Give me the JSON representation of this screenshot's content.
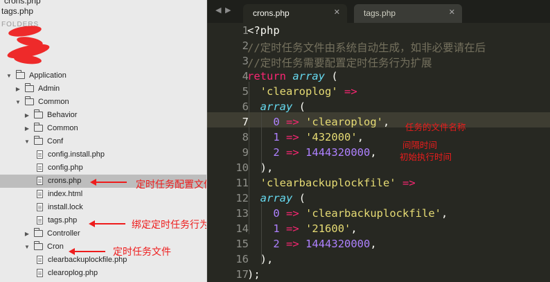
{
  "sidebar": {
    "open_files": [
      "crons.php",
      "tags.php"
    ],
    "section_header": "FOLDERS",
    "tree": [
      {
        "label": "Application",
        "type": "folder",
        "expanded": true
      },
      {
        "label": "Admin",
        "type": "folder",
        "expanded": false
      },
      {
        "label": "Common",
        "type": "folder",
        "expanded": true
      },
      {
        "label": "Behavior",
        "type": "folder",
        "expanded": false
      },
      {
        "label": "Common",
        "type": "folder",
        "expanded": false
      },
      {
        "label": "Conf",
        "type": "folder",
        "expanded": true
      },
      {
        "label": "config.install.php",
        "type": "file"
      },
      {
        "label": "config.php",
        "type": "file"
      },
      {
        "label": "crons.php",
        "type": "file",
        "selected": true
      },
      {
        "label": "index.html",
        "type": "file"
      },
      {
        "label": "install.lock",
        "type": "file"
      },
      {
        "label": "tags.php",
        "type": "file"
      },
      {
        "label": "Controller",
        "type": "folder",
        "expanded": false
      },
      {
        "label": "Cron",
        "type": "folder",
        "expanded": true
      },
      {
        "label": "clearbackuplockfile.php",
        "type": "file"
      },
      {
        "label": "clearoplog.php",
        "type": "file"
      }
    ]
  },
  "annotations": {
    "crons_config": "定时任务配置文件",
    "tags_binding": "绑定定时任务行为到app_end标签上",
    "cron_folder": "定时任务文件",
    "file_name": "任务的文件名称",
    "interval": "间隔时间",
    "start_time": "初始执行时间"
  },
  "tabs": [
    {
      "label": "crons.php",
      "active": true
    },
    {
      "label": "tags.php",
      "active": false
    }
  ],
  "icons": {
    "nav_left": "chevron-left-icon",
    "nav_right": "chevron-right-icon",
    "close": "close-icon",
    "folder": "folder-icon",
    "file": "file-icon"
  },
  "editor": {
    "current_line": 7,
    "line_numbers": [
      "1",
      "2",
      "3",
      "4",
      "5",
      "6",
      "7",
      "8",
      "9",
      "10",
      "11",
      "12",
      "13",
      "14",
      "15",
      "16",
      "17"
    ],
    "lines": [
      "<?php",
      "//定时任务文件由系统自动生成，如非必要请在后",
      "//定时任务需要配置定时任务行为扩展",
      "return array (",
      "  'clearoplog' =>",
      "  array (",
      "    0 => 'clearoplog',",
      "    1 => '432000',",
      "    2 => 1444320000,",
      "  ),",
      "  'clearbackuplockfile' =>",
      "  array (",
      "    0 => 'clearbackuplockfile',",
      "    1 => '21600',",
      "    2 => 1444320000,",
      "  ),",
      ");"
    ]
  },
  "colors": {
    "annotation": "#ee1c1c",
    "editor_bg": "#272822",
    "keyword": "#f92672",
    "string": "#e6db74",
    "number": "#ae81ff",
    "builtin": "#66d9ef",
    "comment": "#75715e"
  }
}
